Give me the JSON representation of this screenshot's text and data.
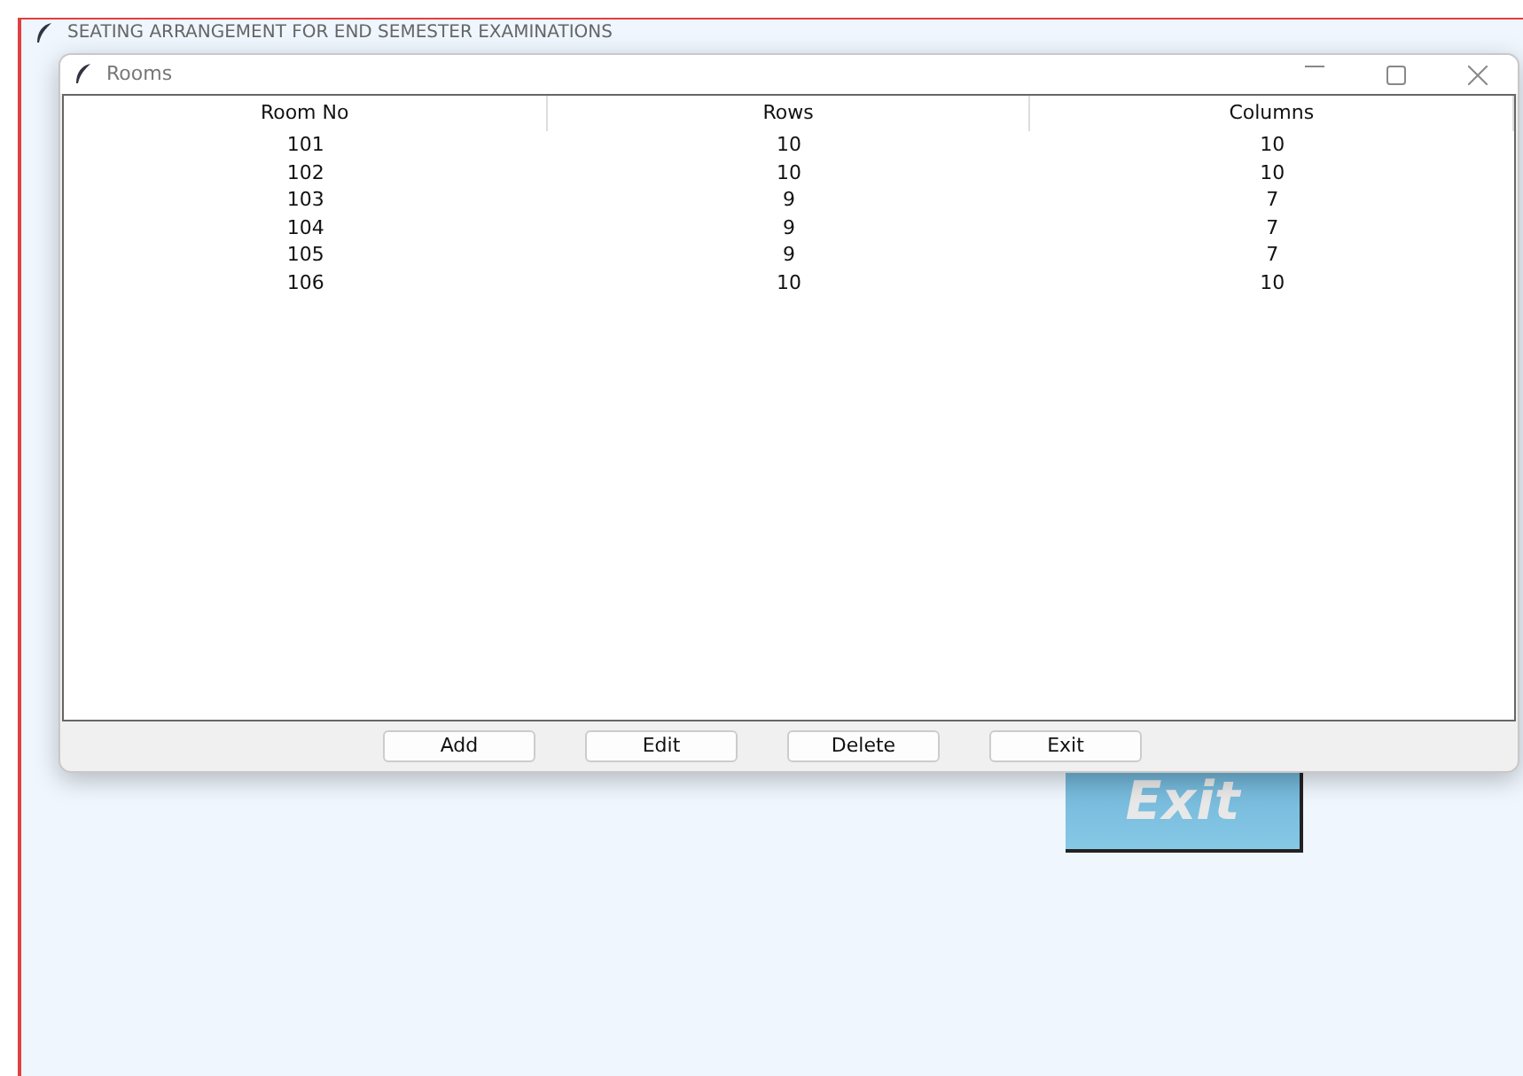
{
  "main_window": {
    "title": "SEATING ARRANGEMENT FOR END SEMESTER EXAMINATIONS",
    "exit_button": "Exit"
  },
  "dialog": {
    "title": "Rooms",
    "table": {
      "columns": [
        "Room No",
        "Rows",
        "Columns"
      ],
      "rows": [
        [
          "101",
          "10",
          "10"
        ],
        [
          "102",
          "10",
          "10"
        ],
        [
          "103",
          "9",
          "7"
        ],
        [
          "104",
          "9",
          "7"
        ],
        [
          "105",
          "9",
          "7"
        ],
        [
          "106",
          "10",
          "10"
        ]
      ]
    },
    "buttons": [
      "Add",
      "Edit",
      "Delete",
      "Exit"
    ]
  }
}
